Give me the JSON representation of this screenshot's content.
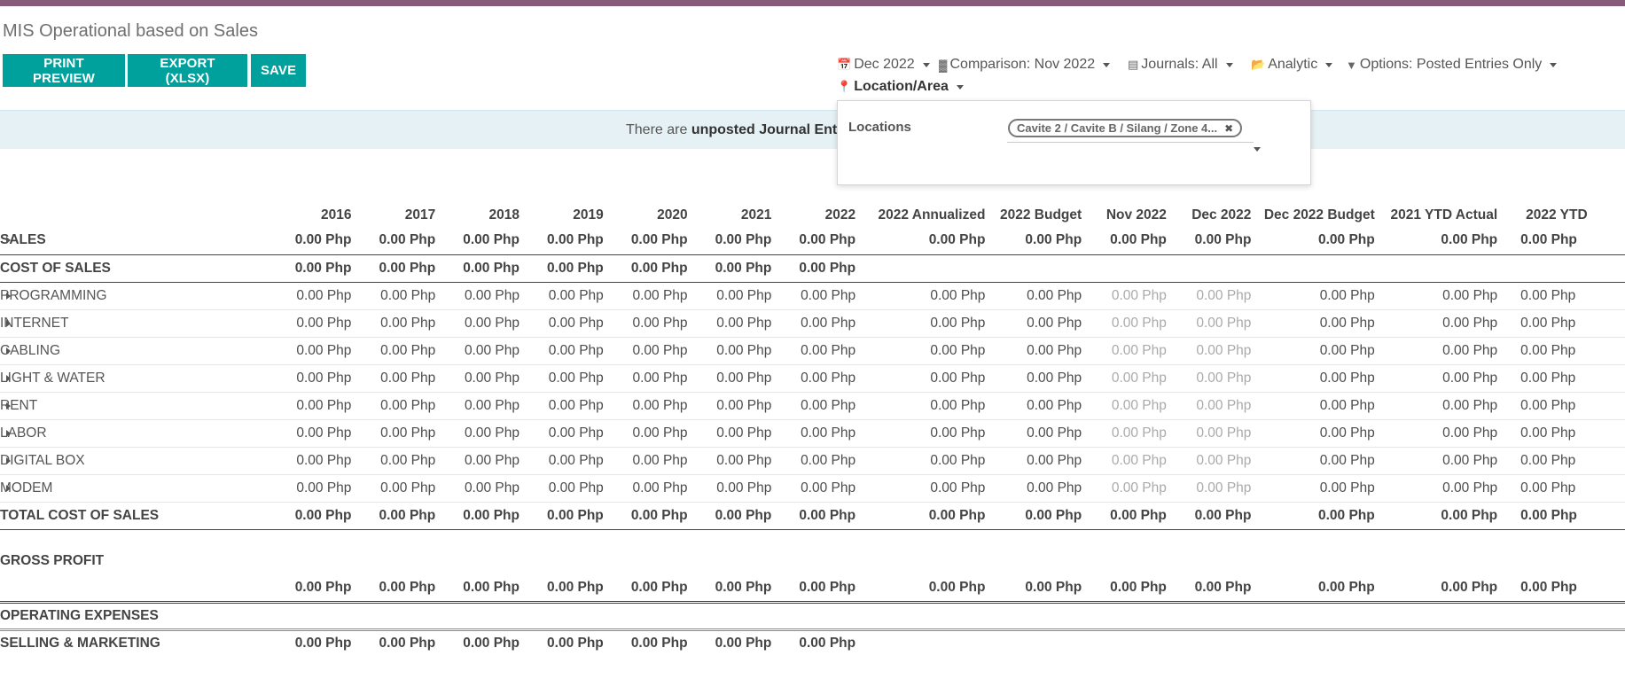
{
  "page": {
    "title": "MIS Operational based on Sales"
  },
  "toolbar": {
    "print_label": "PRINT PREVIEW",
    "export_label": "EXPORT (XLSX)",
    "save_label": "SAVE"
  },
  "filters": {
    "date": "Dec 2022",
    "comparison": "Comparison: Nov 2022",
    "journals": "Journals: All",
    "analytic": "Analytic",
    "options": "Options: Posted Entries Only",
    "location": "Location/Area"
  },
  "notice": {
    "prefix": "There are ",
    "bold": "unposted Journal Entrie"
  },
  "location_dropdown": {
    "label": "Locations",
    "tag": "Cavite 2 / Cavite B / Silang / Zone 4..."
  },
  "table": {
    "columns": [
      "2016",
      "2017",
      "2018",
      "2019",
      "2020",
      "2021",
      "2022",
      "2022 Annualized",
      "2022 Budget",
      "Nov 2022",
      "Dec 2022",
      "Dec 2022 Budget",
      "2021 YTD Actual",
      "2022 YTD"
    ],
    "value": "0.00 Php",
    "rows": {
      "sales": "SALES",
      "cost_of_sales": "COST OF SALES",
      "programming": "PROGRAMMING",
      "internet": "INTERNET",
      "cabling": "CABLING",
      "light_water": "LIGHT & WATER",
      "rent": "RENT",
      "labor": "LABOR",
      "digital_box": "DIGITAL BOX",
      "modem": "MODEM",
      "total_cost_of_sales": "TOTAL COST OF SALES",
      "gross_profit": "GROSS PROFIT",
      "operating_expenses": "OPERATING EXPENSES",
      "selling_marketing": "SELLING & MARKETING"
    }
  },
  "colors": {
    "brand": "#875a7b",
    "button": "#00a09d",
    "notice_bg": "#e5f1f5"
  }
}
